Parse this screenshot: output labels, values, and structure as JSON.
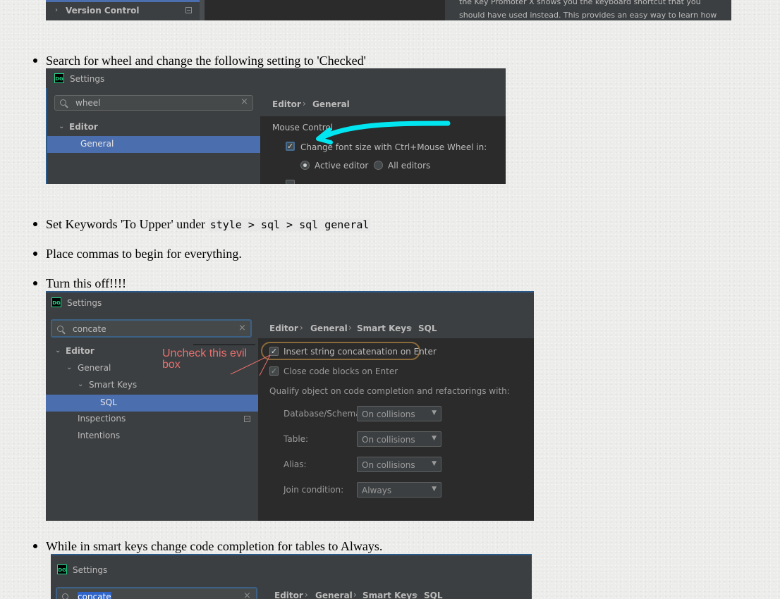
{
  "top_shot": {
    "sidebar_item": "Version Control",
    "right_text_line1": "the Key Promoter X shows you the keyboard shortcut that you",
    "right_text_line2": "should have used instead. This provides an easy way to learn how"
  },
  "bullets": {
    "b1": "Search for wheel and change the following setting to 'Checked'",
    "b2_prefix": "Set Keywords 'To Upper' under",
    "b2_code": "style > sql > sql general",
    "b3": "Place commas to begin for everything.",
    "b4": "Turn this off!!!!",
    "b5": "While in smart keys change code completion for tables to Always."
  },
  "shot1": {
    "logo": "DG",
    "title": "Settings",
    "search_value": "wheel",
    "tree": [
      "Editor",
      "General"
    ],
    "breadcrumb": [
      "Editor",
      "General"
    ],
    "section": "Mouse Control",
    "option": "Change font size with Ctrl+Mouse Wheel in:",
    "radio_active": "Active editor",
    "radio_all": "All editors",
    "arrow_color": "#00e5f0"
  },
  "shot2": {
    "logo": "DG",
    "title": "Settings",
    "search_value": "concate",
    "tree": [
      "Editor",
      "General",
      "Smart Keys",
      "SQL",
      "Inspections",
      "Intentions"
    ],
    "breadcrumb": [
      "Editor",
      "General",
      "Smart Keys",
      "SQL"
    ],
    "option1": "Insert string concatenation on Enter",
    "option2": "Close code blocks on Enter",
    "qualify_heading": "Qualify object on code completion and refactorings with:",
    "rows": [
      {
        "label": "Database/Schema:",
        "value": "On collisions"
      },
      {
        "label": "Table:",
        "value": "On collisions"
      },
      {
        "label": "Alias:",
        "value": "On collisions"
      },
      {
        "label": "Join condition:",
        "value": "Always"
      }
    ],
    "annotation_line1": "Uncheck this evil",
    "annotation_line2": "box",
    "annotation_color": "#e8706e"
  },
  "shot3": {
    "logo": "DG",
    "title": "Settings",
    "search_value": "concate",
    "breadcrumb": [
      "Editor",
      "General",
      "Smart Keys",
      "SQL"
    ]
  }
}
